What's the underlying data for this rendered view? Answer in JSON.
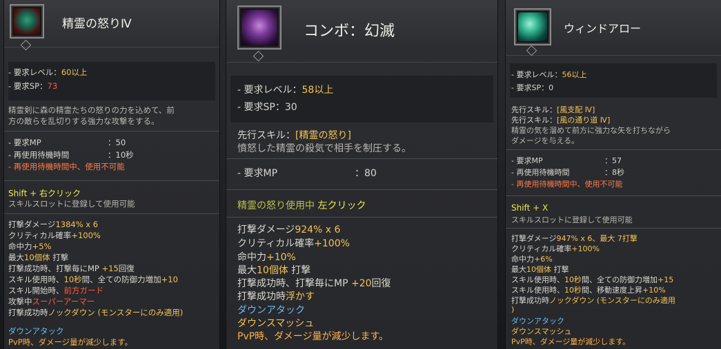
{
  "panels": [
    {
      "title": "精霊の怒りⅣ",
      "icon": "green-spirit-skill-icon",
      "req_level_label": "- 要求レベル：",
      "req_level_value": "60以上",
      "req_sp_label": "- 要求SP：",
      "req_sp_value": "73",
      "desc": [
        "精霊剣に森の精霊たちの怒りの力を込めて、前",
        "方の敵らを乱切りする強力な攻撃をする。"
      ],
      "mp_label": "- 要求MP",
      "mp_value": "：50",
      "cd_label": "- 再使用待機時間",
      "cd_value": "：10秒",
      "cd_warn": "- 再使用待機時間中、使用不可能",
      "key": "Shift + 右クリック",
      "key_note": "スキルスロットに登録して使用可能",
      "effects": [
        {
          "a": "打撃ダメージ",
          "b": "1384% x 6",
          "c": ""
        },
        {
          "a": "クリティカル確率",
          "b": "+100%",
          "c": ""
        },
        {
          "a": "命中力",
          "b": "+5%",
          "c": ""
        },
        {
          "a": "最大",
          "b": "10個体",
          "c": " 打撃"
        },
        {
          "a": "打撃成功時、打撃毎にMP ",
          "b": "+15",
          "c": "回復"
        },
        {
          "a": "スキル使用時、",
          "b": "10秒",
          "c": "間、全ての防御力増加",
          "d": "+10"
        },
        {
          "a": "スキル開始時、",
          "r": "前方ガード"
        },
        {
          "a": "攻撃中",
          "r": "スーパーアーマー"
        },
        {
          "a": "打撃成功時",
          "b": "ノックダウン",
          "c": " (モンスターにのみ適用",
          "d": ")"
        }
      ],
      "blue": "ダウンアタック",
      "pvp": "PvP時、ダメージ量が減少します。"
    },
    {
      "title": "コンボ：幻滅",
      "icon": "purple-mask-skill-icon",
      "req_level_label": "- 要求レベル：",
      "req_level_value": "58以上",
      "req_sp_label": "- 要求SP：",
      "req_sp_value": "30",
      "prereq_label": "先行スキル：",
      "prereq_value": "[精霊の怒り]",
      "desc": [
        "憤怒した精霊の殺気で相手を制圧する。"
      ],
      "mp_label": "- 要求MP",
      "mp_value": "：80",
      "key_prefix": "精霊の怒り使用中 ",
      "key": "左クリック",
      "effects": [
        {
          "a": "打撃ダメージ",
          "b": "924% x 6"
        },
        {
          "a": "クリティカル確率",
          "b": "+100%"
        },
        {
          "a": "命中力",
          "b": "+10%"
        },
        {
          "a": "最大",
          "b": "10個体",
          "c": " 打撃"
        },
        {
          "a": "打撃成功時、打撃毎にMP ",
          "b": "+20",
          "c": "回復"
        },
        {
          "a": "打撃成功時",
          "b": "浮かす"
        }
      ],
      "blue": "ダウンアタック",
      "yellow": "ダウンスマッシュ",
      "pvp": "PvP時、ダメージ量が減少します。"
    },
    {
      "title": "ウィンドアロー",
      "icon": "teal-wind-skill-icon",
      "req_level_label": "- 要求レベル：",
      "req_level_value": "56以上",
      "req_sp_label": "- 要求SP：",
      "req_sp_value": "0",
      "prereq": [
        {
          "label": "先行スキル：",
          "value": "[風支配 Ⅳ]"
        },
        {
          "label": "先行スキル：",
          "value": "[風の通り道 Ⅳ]"
        }
      ],
      "desc": [
        "精霊の気を溜めて前方に強力な矢を打ちながら",
        "ダメージを与える。"
      ],
      "mp_label": "- 要求MP",
      "mp_value": "：57",
      "cd_label": "- 再使用待機時間",
      "cd_value": "：8秒",
      "cd_warn": "- 再使用待機時間中、使用不可能",
      "key": "Shift + X",
      "key_note": "スキルスロットに登録して使用可能",
      "effects": [
        {
          "a": "打撃ダメージ",
          "b": "947% x 6、最大 7打撃"
        },
        {
          "a": "クリティカル確率",
          "b": "+100%"
        },
        {
          "a": "命中力",
          "b": "+6%"
        },
        {
          "a": "最大",
          "b": "10個体",
          "c": " 打撃"
        },
        {
          "a": "スキル使用時、",
          "b": "10秒",
          "c": "間、全ての防御力増加",
          "d": "+15"
        },
        {
          "a": "スキル使用時、",
          "b": "10秒",
          "c": "間、移動速度上昇",
          "d": "+10%"
        },
        {
          "a": "打撃成功時",
          "b": "ノックダウン",
          "c": " (モンスターにのみ適用",
          "d": ""
        }
      ],
      "blue_prefix": ")",
      "blue": "ダウンアタック",
      "yellow": "ダウンスマッシュ",
      "pvp": "PvP時、ダメージ量が減少します。"
    }
  ],
  "colors": {
    "gold": "#f6c453",
    "red": "#ff5a3c",
    "blue": "#6bbcf0",
    "key": "#e8ec4a"
  }
}
